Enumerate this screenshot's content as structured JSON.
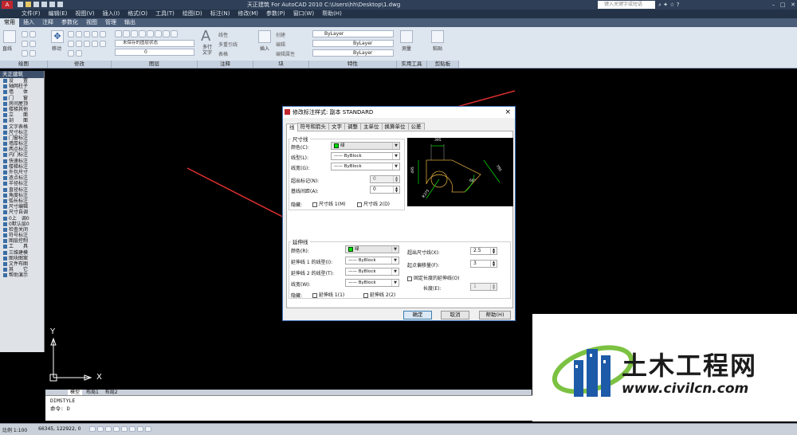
{
  "window": {
    "title": "天正建筑 For AutoCAD 2010    C:\\Users\\hh\\Desktop\\1.dwg",
    "search_placeholder": "键入关键字或短语"
  },
  "menu": [
    "文件(F)",
    "编辑(E)",
    "视图(V)",
    "插入(I)",
    "格式(O)",
    "工具(T)",
    "绘图(D)",
    "标注(N)",
    "修改(M)",
    "参数(P)",
    "窗口(W)",
    "帮助(H)"
  ],
  "ribbon_tabs": [
    "常用",
    "插入",
    "注释",
    "参数化",
    "视图",
    "管理",
    "输出"
  ],
  "ribbon": {
    "groups": [
      "绘图",
      "修改",
      "图层",
      "注释",
      "块",
      "特性",
      "实用工具",
      "剪贴板"
    ],
    "draw_label": "直线",
    "modify_label": "移动",
    "layer_state": "未保存的图层状态",
    "layer_current": "0",
    "text_label": "多行文字",
    "dim_label": "线性",
    "leader_label": "多重引线",
    "table_label": "表格",
    "insert_label": "插入",
    "create_label": "创建",
    "edit_label": "编辑",
    "edit_attr_label": "编辑属性",
    "prop_color": "ByLayer",
    "prop_linetype": "ByLayer",
    "prop_lineweight": "ByLayer",
    "measure_label": "测量",
    "paste_label": "粘贴"
  },
  "left_panel": {
    "title": "天正建筑",
    "items": [
      "设　　置",
      "轴网柱子",
      "墙　　体",
      "门　　窗",
      "房间屋顶",
      "楼梯其他",
      "立　　面",
      "剖　　面",
      "文字表格",
      "尺寸标注",
      "门窗标注",
      "墙厚标注",
      "两点标注",
      "内门标注",
      "快速标注",
      "楼梯标注",
      "外包尺寸",
      "逐点标注",
      "半径标注",
      "直径标注",
      "角度标注",
      "弧长标注",
      "尺寸编辑",
      "尺寸自调",
      "0上　调0",
      "0默认层0",
      "检查关闭",
      "符号标注",
      "图层控制",
      "工　　具",
      "三维建模",
      "图块图案",
      "文件布图",
      "其　　它",
      "帮助演示"
    ]
  },
  "dialog": {
    "title": "修改标注样式: 副本 STANDARD",
    "close": "×",
    "tabs": [
      "线",
      "符号和箭头",
      "文字",
      "调整",
      "主单位",
      "换算单位",
      "公差"
    ],
    "dimline": {
      "title": "尺寸线",
      "color_label": "颜色(C):",
      "color_value": "绿",
      "linetype_label": "线型(L):",
      "linetype_value": "—— ByBlock",
      "lineweight_label": "线宽(G):",
      "lineweight_value": "—— ByBlock",
      "extend_label": "超出标记(N):",
      "extend_value": "0",
      "baseline_label": "基线间距(A):",
      "baseline_value": "0",
      "suppress_label": "隐藏:",
      "suppress1": "尺寸线 1(M)",
      "suppress2": "尺寸线 2(D)"
    },
    "preview": {
      "d1": "395",
      "d2": "495",
      "d3": "785",
      "angle": "60°",
      "radius": "R375"
    },
    "extline": {
      "title": "延伸线",
      "color_label": "颜色(R):",
      "color_value": "绿",
      "lt1_label": "延伸线 1 的线型(I):",
      "lt1_value": "—— ByBlock",
      "lt2_label": "延伸线 2 的线型(T):",
      "lt2_value": "—— ByBlock",
      "lw_label": "线宽(W):",
      "lw_value": "—— ByBlock",
      "suppress_label": "隐藏:",
      "suppress1": "延伸线 1(1)",
      "suppress2": "延伸线 2(2)",
      "beyond_label": "超出尺寸线(X):",
      "beyond_value": "2.5",
      "offset_label": "起点偏移量(F):",
      "offset_value": "3",
      "fixed_label": "固定长度的延伸线(O)",
      "length_label": "长度(E):",
      "length_value": "1"
    },
    "ok": "确定",
    "cancel": "取消",
    "help": "帮助(H)"
  },
  "layout_tabs": [
    "模型",
    "布局1",
    "布局2"
  ],
  "command": {
    "line1": "DIMSTYLE",
    "line2": "命令: D"
  },
  "status": {
    "scale": "比例 1:100",
    "coords": "66345, 122922, 0"
  },
  "ucs": {
    "y": "Y",
    "x": "X"
  },
  "watermark": {
    "name": "土木工程网",
    "url": "www.civilcn.com"
  }
}
